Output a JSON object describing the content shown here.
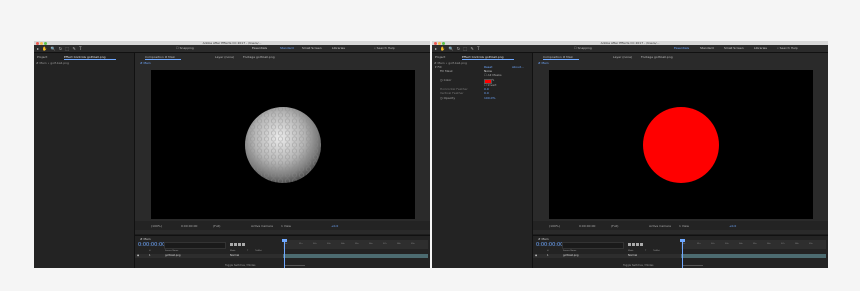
{
  "windows": [
    {
      "title": "Adobe After Effects CC 2017 - /Users/...",
      "toolbar": {
        "tool_glyphs": "▸ ✋ 🔍 ↻ ⬚ ✎ T",
        "snapping_label": "Snapping",
        "workspaces": [
          "Essentials",
          "Standard",
          "Small Screen",
          "Libraries"
        ],
        "active_workspace_index": 1,
        "search_help": "Search Help"
      },
      "left_panel": {
        "tabs": [
          "Project",
          "Effect Controls golf-ball.png"
        ],
        "subtitle": "# Main • golf-ball.png"
      },
      "viewer": {
        "tabs": [
          "Composition # Main",
          "Layer (none)",
          "Footage golf-ball.png"
        ],
        "breadcrumb": "# Main",
        "image": "golf-ball",
        "controls": [
          "(100%)",
          "0:00:00:00",
          "(Full)",
          "Active Camera",
          "1 View",
          "+0.0"
        ]
      },
      "timeline": {
        "tab": "# Main",
        "timecode": "0:00:00:00",
        "columns": [
          "#",
          "Source Name",
          "Mode",
          "T",
          "TrkMat"
        ],
        "layer": {
          "index": "1",
          "name": "golf-ball.png",
          "mode": "Normal"
        },
        "ruler": [
          "0s",
          "01s",
          "02s",
          "03s",
          "04s",
          "05s",
          "06s",
          "07s",
          "08s",
          "09s",
          "10s"
        ],
        "toggle_label": "Toggle Switches / Modes"
      }
    },
    {
      "title": "Adobe After Effects CC 2017 - /Users/...",
      "toolbar": {
        "tool_glyphs": "▸ ✋ 🔍 ↻ ⬚ ✎ T",
        "snapping_label": "Snapping",
        "workspaces": [
          "Essentials",
          "Standard",
          "Small Screen",
          "Libraries"
        ],
        "active_workspace_index": 0,
        "search_help": "Search Help"
      },
      "left_panel": {
        "tabs": [
          "Project",
          "Effect Controls golf-ball.png"
        ],
        "subtitle": "# Main • golf-ball.png",
        "effect": {
          "name": "Fill",
          "reset_label": "Reset",
          "about_label": "About...",
          "rows": [
            {
              "label": "Fill Mask",
              "value": "None"
            },
            {
              "label": "",
              "value": "All Masks"
            },
            {
              "label": "Color",
              "value": ""
            },
            {
              "label": "",
              "value": "Invert"
            },
            {
              "label": "Horizontal Feather",
              "value": "0.0"
            },
            {
              "label": "Vertical Feather",
              "value": "0.0"
            },
            {
              "label": "Opacity",
              "value": "100.0%"
            }
          ],
          "fill_color": "#ff0000"
        }
      },
      "viewer": {
        "tabs": [
          "Composition # Main",
          "Layer (none)",
          "Footage golf-ball.png"
        ],
        "breadcrumb": "# Main",
        "image": "red-circle",
        "circle_color": "#ff0000",
        "controls": [
          "(100%)",
          "0:00:00:00",
          "(Full)",
          "Active Camera",
          "1 View",
          "+0.0"
        ]
      },
      "timeline": {
        "tab": "# Main",
        "timecode": "0:00:00:00",
        "columns": [
          "#",
          "Source Name",
          "Mode",
          "T",
          "TrkMat"
        ],
        "layer": {
          "index": "1",
          "name": "golf-ball.png",
          "mode": "Normal"
        },
        "ruler": [
          "0s",
          "01s",
          "02s",
          "03s",
          "04s",
          "05s",
          "06s",
          "07s",
          "08s",
          "09s",
          "10s"
        ],
        "toggle_label": "Toggle Switches / Modes"
      }
    }
  ]
}
